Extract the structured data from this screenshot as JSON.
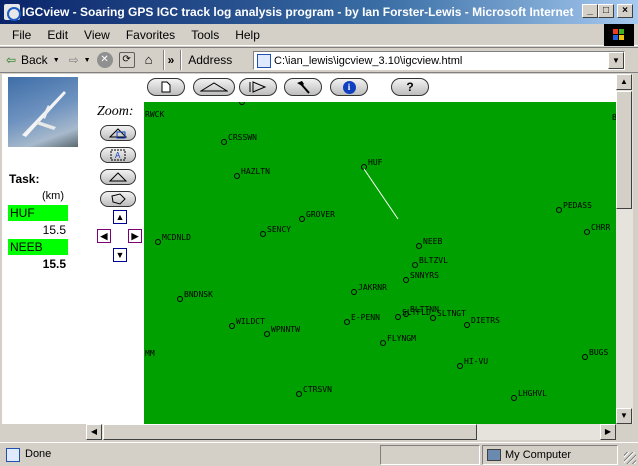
{
  "window": {
    "title": "IGCview - Soaring GPS IGC track log analysis program - by Ian Forster-Lewis - Microsoft Internet ...",
    "minimize": "_",
    "maximize": "□",
    "close": "×"
  },
  "menu": [
    "File",
    "Edit",
    "View",
    "Favorites",
    "Tools",
    "Help"
  ],
  "nav": {
    "back_label": "Back",
    "address_label": "Address",
    "address_value": "C:\\ian_lewis\\igcview_3.10\\igcview.html",
    "more": "»"
  },
  "toolbar_buttons": [
    "new-page",
    "triangle",
    "play",
    "hammer",
    "info",
    "help"
  ],
  "help_label": "?",
  "task": {
    "title": "Task:",
    "unit": "(km)",
    "waypoints": [
      {
        "name": "HUF",
        "distance": "15.5"
      },
      {
        "name": "NEEB",
        "distance": "15.5"
      }
    ]
  },
  "zoom": {
    "label": "Zoom:",
    "buttons": [
      "zoom-to-flight",
      "zoom-in-area",
      "zoom-to-task",
      "zoom-to-region"
    ],
    "pan": {
      "up": "▲",
      "left": "◀",
      "right": "▶",
      "down": "▼"
    }
  },
  "map": {
    "background": "#00a000",
    "track_color": "#ffffff",
    "labels": [
      "RWCK",
      "CRSSWN",
      "HAZLTN",
      "HUF",
      "GROVER",
      "SENCY",
      "MCDNLD",
      "NEEB",
      "PEDASS",
      "CHRR",
      "BLTZVL",
      "SNNYRS",
      "JAKRNR",
      "BNDNSK",
      "SLTFLD",
      "BLTTNN",
      "SLTNGT",
      "E-PENN",
      "DIETRS",
      "WILDCT",
      "WPNNTW",
      "FLYNGM",
      "MM",
      "BUGS",
      "HI-VU",
      "CTRSVN",
      "LHGHVL",
      "B"
    ]
  },
  "status": {
    "text": "Done",
    "zone": "My Computer"
  }
}
